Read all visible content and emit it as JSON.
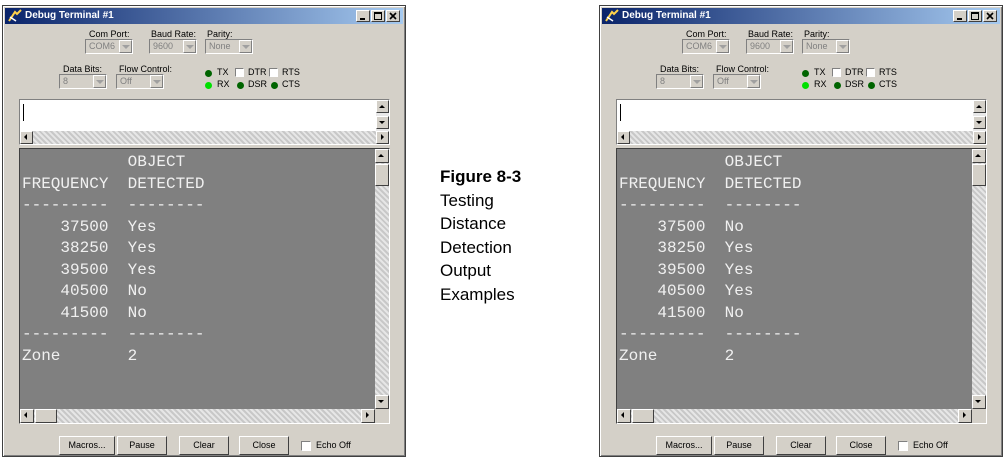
{
  "window_title": "Debug Terminal #1",
  "labels": {
    "com_port": "Com Port:",
    "baud_rate": "Baud Rate:",
    "parity": "Parity:",
    "data_bits": "Data Bits:",
    "flow_control": "Flow Control:"
  },
  "values": {
    "com_port": "COM6",
    "baud_rate": "9600",
    "parity": "None",
    "data_bits": "8",
    "flow_control": "Off"
  },
  "indicators": {
    "tx": "TX",
    "rx": "RX",
    "dtr": "DTR",
    "rts": "RTS",
    "dsr": "DSR",
    "cts": "CTS"
  },
  "colors": {
    "led_dark": "#006400",
    "led_light": "#00e000",
    "terminal_bg": "#808080",
    "terminal_text": "#f0f0f0"
  },
  "buttons": {
    "macros": "Macros...",
    "pause": "Pause",
    "clear": "Clear",
    "close": "Close",
    "echo_off": "Echo Off"
  },
  "figure": {
    "label": "Figure 8-3",
    "lines": [
      "Testing",
      "Distance",
      "Detection",
      "Output",
      "Examples"
    ]
  },
  "terminal1": {
    "lines": [
      "           OBJECT",
      "FREQUENCY  DETECTED",
      "---------  --------",
      "    37500  Yes",
      "    38250  Yes",
      "    39500  Yes",
      "    40500  No",
      "    41500  No",
      "---------  --------",
      "Zone       2"
    ]
  },
  "terminal2": {
    "lines": [
      "           OBJECT",
      "FREQUENCY  DETECTED",
      "---------  --------",
      "    37500  No",
      "    38250  Yes",
      "    39500  Yes",
      "    40500  Yes",
      "    41500  No",
      "---------  --------",
      "Zone       2"
    ]
  }
}
